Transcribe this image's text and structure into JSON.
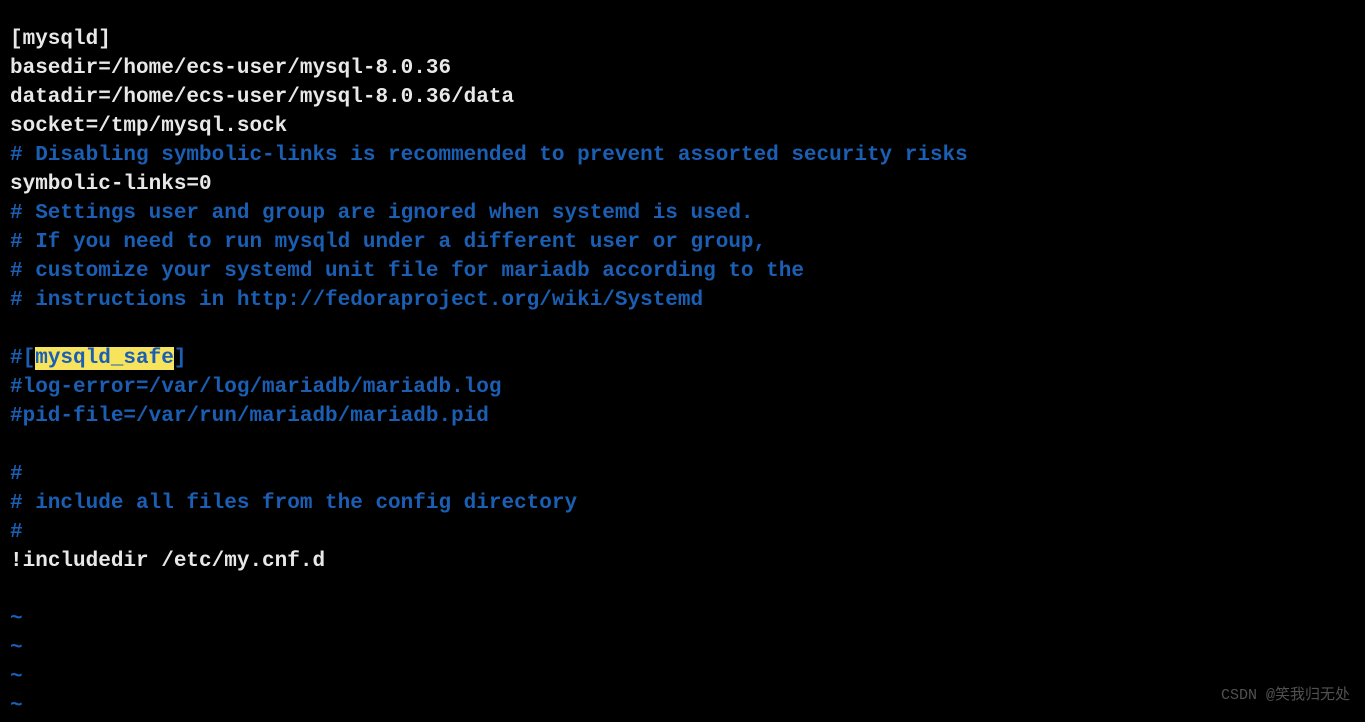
{
  "editor": {
    "lines": [
      {
        "type": "white",
        "text": "[mysqld]"
      },
      {
        "type": "white",
        "text": "basedir=/home/ecs-user/mysql-8.0.36"
      },
      {
        "type": "white",
        "text": "datadir=/home/ecs-user/mysql-8.0.36/data"
      },
      {
        "type": "white",
        "text": "socket=/tmp/mysql.sock"
      },
      {
        "type": "comment",
        "text": "# Disabling symbolic-links is recommended to prevent assorted security risks"
      },
      {
        "type": "white",
        "text": "symbolic-links=0"
      },
      {
        "type": "comment",
        "text": "# Settings user and group are ignored when systemd is used."
      },
      {
        "type": "comment",
        "text": "# If you need to run mysqld under a different user or group,"
      },
      {
        "type": "comment",
        "text": "# customize your systemd unit file for mariadb according to the"
      },
      {
        "type": "comment",
        "text": "# instructions in http://fedoraproject.org/wiki/Systemd"
      },
      {
        "type": "blank",
        "text": ""
      },
      {
        "type": "mixed",
        "segments": [
          {
            "class": "comment",
            "text": "#["
          },
          {
            "class": "highlight",
            "text": "mysqld_safe"
          },
          {
            "class": "comment",
            "text": "]"
          }
        ]
      },
      {
        "type": "comment",
        "text": "#log-error=/var/log/mariadb/mariadb.log"
      },
      {
        "type": "comment",
        "text": "#pid-file=/var/run/mariadb/mariadb.pid"
      },
      {
        "type": "blank",
        "text": ""
      },
      {
        "type": "comment",
        "text": "#"
      },
      {
        "type": "comment",
        "text": "# include all files from the config directory"
      },
      {
        "type": "comment",
        "text": "#"
      },
      {
        "type": "mixed",
        "segments": [
          {
            "class": "cursor",
            "text": "!"
          },
          {
            "class": "white",
            "text": "includedir /etc/my.cnf.d"
          }
        ]
      },
      {
        "type": "blank",
        "text": ""
      },
      {
        "type": "tilde",
        "text": "~"
      },
      {
        "type": "tilde",
        "text": "~"
      },
      {
        "type": "tilde",
        "text": "~"
      },
      {
        "type": "tilde",
        "text": "~"
      }
    ]
  },
  "watermark": "CSDN @笑我归无处"
}
